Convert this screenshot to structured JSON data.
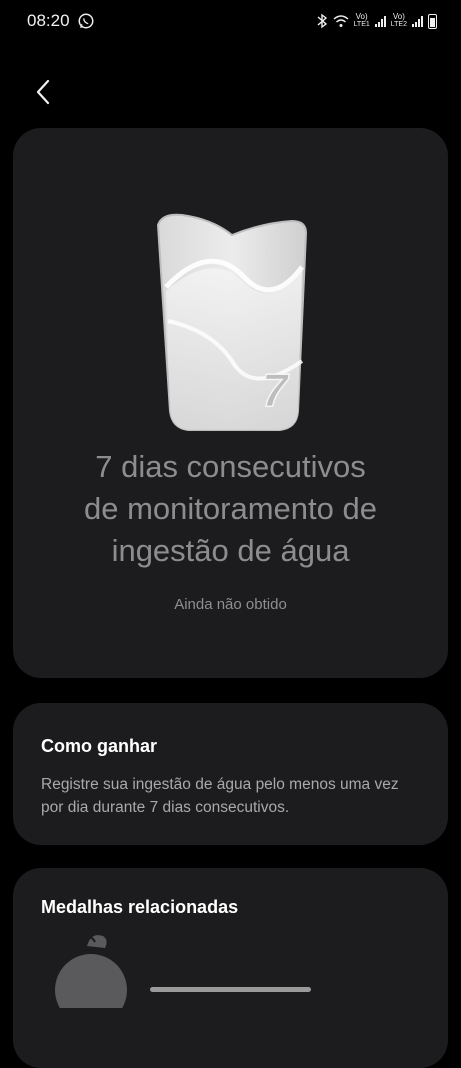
{
  "status_bar": {
    "time": "08:20",
    "net1_top": "Vo)",
    "net1_bottom": "LTE1",
    "net2_top": "Vo)",
    "net2_bottom": "LTE2"
  },
  "medal": {
    "number": "7",
    "title_line1": "7 dias consecutivos",
    "title_line2": "de monitoramento de",
    "title_line3": "ingestão de água",
    "status": "Ainda não obtido"
  },
  "how_to_earn": {
    "title": "Como ganhar",
    "description": "Registre sua ingestão de água pelo menos uma vez por dia durante 7 dias consecutivos."
  },
  "related": {
    "title": "Medalhas relacionadas"
  },
  "icons": {
    "back": "chevron-left-icon",
    "whatsapp": "whatsapp-icon",
    "bluetooth": "bluetooth-icon",
    "wifi": "wifi-icon",
    "battery": "battery-icon"
  }
}
